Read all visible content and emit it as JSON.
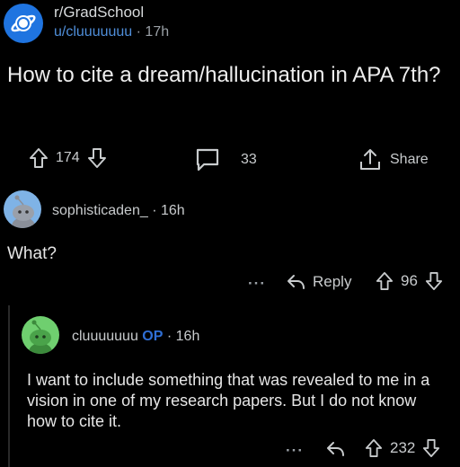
{
  "post": {
    "subreddit": "r/GradSchool",
    "author": "u/cluuuuuuu",
    "separator": "·",
    "time": "17h",
    "title": "How to cite a dream/hallucination in APA 7th?",
    "upvotes": "174",
    "comments": "33",
    "share_label": "Share"
  },
  "comment1": {
    "author": "sophisticaden_",
    "separator": "·",
    "time": "16h",
    "body": "What?",
    "more": "···",
    "reply_label": "Reply",
    "votes": "96"
  },
  "comment2": {
    "author": "cluuuuuuu",
    "op_badge": "OP",
    "separator": "·",
    "time": "16h",
    "body": "I want to include something that was revealed to me in a vision in one of my research papers. But I do not know how to cite it.",
    "more": "···",
    "votes": "232"
  }
}
